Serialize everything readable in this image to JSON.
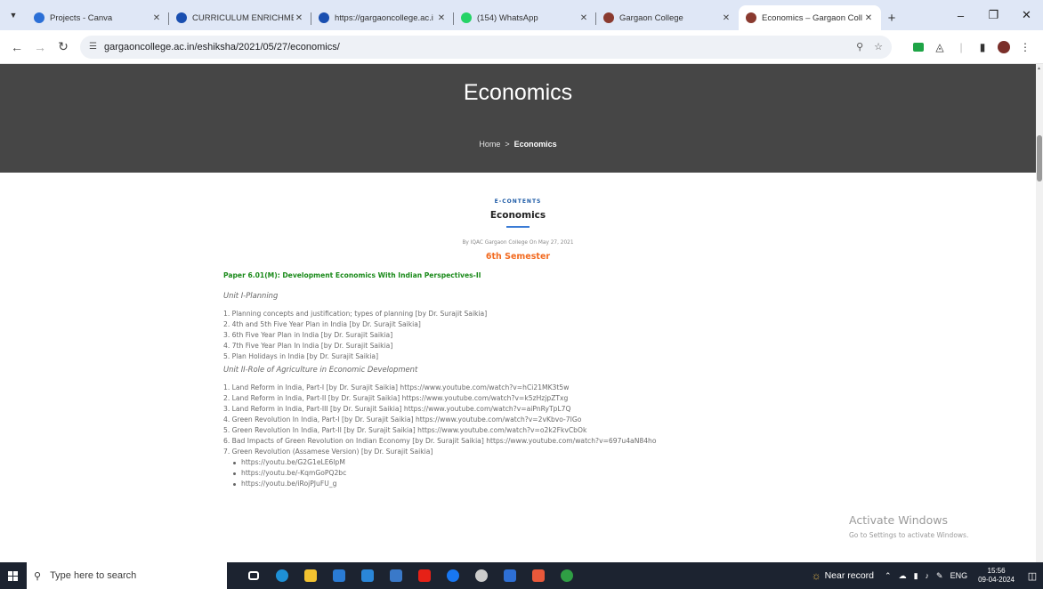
{
  "browser": {
    "tabs": [
      {
        "title": "Projects - Canva",
        "icon": "canva-icon",
        "color": "#2b6fd6",
        "active": false
      },
      {
        "title": "CURRICULUM ENRICHMEN",
        "icon": "globe-icon",
        "color": "#1a4fb0",
        "active": false
      },
      {
        "title": "https://gargaoncollege.ac.i",
        "icon": "globe-icon",
        "color": "#1a4fb0",
        "active": false
      },
      {
        "title": "(154) WhatsApp",
        "icon": "whatsapp-icon",
        "color": "#25d366",
        "active": false
      },
      {
        "title": "Gargaon College",
        "icon": "college-logo-icon",
        "color": "#8a3a2f",
        "active": false
      },
      {
        "title": "Economics – Gargaon Coll",
        "icon": "college-logo-icon",
        "color": "#8a3a2f",
        "active": true
      }
    ],
    "url": "gargaoncollege.ac.in/eshiksha/2021/05/27/economics/"
  },
  "page": {
    "hero_title": "Economics",
    "breadcrumb": {
      "home": "Home",
      "separator": ">",
      "current": "Economics"
    },
    "category": "E-CONTENTS",
    "post_title": "Economics",
    "meta": "By IQAC Gargaon College  On May 27, 2021",
    "semester": "6th Semester",
    "paper": "Paper 6.01(M): Development Economics With Indian Perspectives-II",
    "unit1": {
      "heading": "Unit I-Planning",
      "items": [
        "1. Planning concepts and justification; types of planning [by Dr. Surajit Saikia]",
        "2. 4th and 5th Five Year Plan in India [by Dr. Surajit Saikia]",
        "3. 6th Five Year Plan in India [by Dr. Surajit Saikia]",
        "4. 7th Five Year Plan In India [by Dr. Surajit Saikia]",
        "5. Plan Holidays in India [by Dr. Surajit Saikia]"
      ]
    },
    "unit2": {
      "heading": "Unit II-Role of Agriculture in Economic Development",
      "items": [
        "1. Land Reform in India, Part-I [by Dr. Surajit Saikia] https://www.youtube.com/watch?v=hCi21MK3t5w",
        "2. Land Reform in India, Part-II [by Dr. Surajit Saikia]  https://www.youtube.com/watch?v=k5zHzjpZTxg",
        "3. Land Reform in India, Part-III [by Dr. Surajit Saikia] https://www.youtube.com/watch?v=aiPnRyTpL7Q",
        "4. Green Revolution In India, Part-I [by Dr. Surajit Saikia] https://www.youtube.com/watch?v=2vKbvo-7IGo",
        "5. Green Revolution In India, Part-II [by Dr. Surajit Saikia] https://www.youtube.com/watch?v=o2k2FkvCbOk",
        "6. Bad Impacts of Green Revolution on Indian Economy [by Dr. Surajit Saikia] https://www.youtube.com/watch?v=697u4aN84ho",
        "7. Green Revolution (Assamese Version) [by Dr. Surajit Saikia]"
      ],
      "links": [
        "https://youtu.be/G2G1eLE6lpM",
        "https://youtu.be/-KqmGoPQ2bc",
        "https://youtu.be/iRojPJuFU_g"
      ]
    },
    "watermark": {
      "title": "Activate Windows",
      "subtitle": "Go to Settings to activate Windows."
    }
  },
  "taskbar": {
    "search_placeholder": "Type here to search",
    "apps": [
      {
        "name": "task-view-icon",
        "color": "#ffffff"
      },
      {
        "name": "edge-icon",
        "color": "#1e90d6"
      },
      {
        "name": "file-explorer-icon",
        "color": "#f2c230"
      },
      {
        "name": "store-icon",
        "color": "#2a7bd4"
      },
      {
        "name": "mail-icon",
        "color": "#2a86d8"
      },
      {
        "name": "calculator-icon",
        "color": "#3a79c9"
      },
      {
        "name": "youtube-icon",
        "color": "#e62117"
      },
      {
        "name": "facebook-icon",
        "color": "#1877f2"
      },
      {
        "name": "settings-icon",
        "color": "#cccccc"
      },
      {
        "name": "photos-icon",
        "color": "#2e6fd4"
      },
      {
        "name": "snipping-tool-icon",
        "color": "#e8583a"
      },
      {
        "name": "chrome-icon",
        "color": "#2f9e44"
      }
    ],
    "weather": "Near record",
    "language": "ENG",
    "time": "15:56",
    "date": "09-04-2024"
  }
}
